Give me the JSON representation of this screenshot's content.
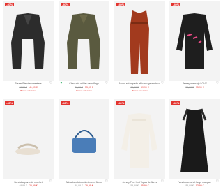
{
  "products": [
    {
      "badge": "-40%",
      "brand": "",
      "title": "Blazer Blender sweatere",
      "old_price": "69,99 €",
      "new_price": "41,99 €",
      "extra": "Blanco coleccion",
      "favorite_icon": "heart-outline-icon",
      "image": {
        "kind": "jacket",
        "color": "#2c2c2c"
      }
    },
    {
      "badge": "-40%",
      "brand": "",
      "title": "Chaqueta militar camuflage",
      "old_price": "89,99 €",
      "new_price": "53,99 €",
      "extra": "Blanco coleccion",
      "favorite_icon": "heart-outline-icon",
      "image": {
        "kind": "jacket",
        "color": "#5a5a3f"
      }
    },
    {
      "badge": "-40%",
      "brand": "",
      "title": "Mono estampado africano geométrico",
      "old_price": "99,99 €",
      "new_price": "59,99 €",
      "extra": "Blanco coleccion",
      "favorite_icon": "heart-outline-icon",
      "image": {
        "kind": "jumpsuit",
        "color": "#a23a1e"
      }
    },
    {
      "badge": "-40%",
      "brand": "",
      "title": "Jersey mensaje LOVE",
      "old_price": "59,99 €",
      "new_price": "35,99 €",
      "extra": "",
      "favorite_icon": "heart-outline-icon",
      "image": {
        "kind": "sweater",
        "color": "#1e1e1e"
      }
    },
    {
      "badge": "-40%",
      "brand": "",
      "title": "Sandalia plana de crochet",
      "old_price": "49,99 €",
      "new_price": "29,99 €",
      "extra": "",
      "favorite_icon": "heart-outline-icon",
      "image": {
        "kind": "sandal",
        "color": "#e8dfd2"
      }
    },
    {
      "badge": "-40%",
      "brand": "",
      "title": "Bolsa bandolera denim con flecos",
      "old_price": "49,99 €",
      "new_price": "29,99 €",
      "extra": "",
      "favorite_icon": "heart-outline-icon",
      "image": {
        "kind": "bag",
        "color": "#4a7db8"
      }
    },
    {
      "badge": "-40%",
      "brand": "",
      "title": "Jersey Fine Knit Topas de flores",
      "old_price": "59,99 €",
      "new_price": "35,99 €",
      "extra": "",
      "favorite_icon": "heart-outline-icon",
      "image": {
        "kind": "sweater",
        "color": "#f3efe7"
      }
    },
    {
      "badge": "-40%",
      "brand": "",
      "title": "Vestido crochet largo mangas",
      "old_price": "89,99 €",
      "new_price": "53,99 €",
      "extra": "",
      "favorite_icon": "heart-outline-icon",
      "image": {
        "kind": "dress",
        "color": "#1a1a1a"
      }
    }
  ]
}
